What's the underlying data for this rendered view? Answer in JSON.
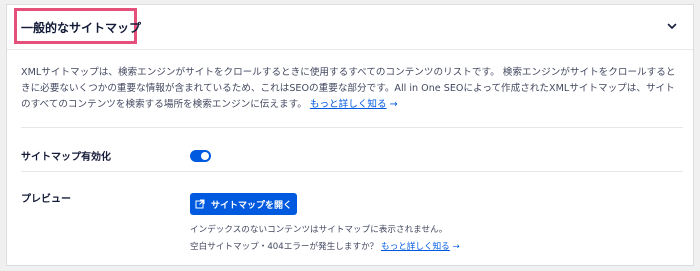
{
  "header": {
    "title": "一般的なサイトマップ",
    "toggle_icon": "chevron-down-icon"
  },
  "description": {
    "text": "XMLサイトマップは、検索エンジンがサイトをクロールするときに使用するすべてのコンテンツのリストです。 検索エンジンがサイトをクロールするときに必要ないくつかの重要な情報が含まれているため、これはSEOの重要な部分です。All in One SEOによって作成されたXMLサイトマップは、サイトのすべてのコンテンツを検索する場所を検索エンジンに伝えます。",
    "link_label": "もっと詳しく知る",
    "arrow": "→"
  },
  "settings": {
    "enable": {
      "label": "サイトマップ有効化",
      "enabled": true
    },
    "preview": {
      "label": "プレビュー",
      "button_label": "サイトマップを開く",
      "button_icon": "external-link-icon",
      "help_line1": "インデックスのないコンテンツはサイトマップに表示されません。",
      "help_line2_prefix": "空白サイトマップ・404エラーが発生しますか？",
      "help_link_label": "もっと詳しく知る",
      "arrow": "→"
    }
  },
  "colors": {
    "accent": "#005ae0",
    "highlight_border": "#e5507a",
    "text": "#141b38",
    "muted_text": "#434960"
  }
}
